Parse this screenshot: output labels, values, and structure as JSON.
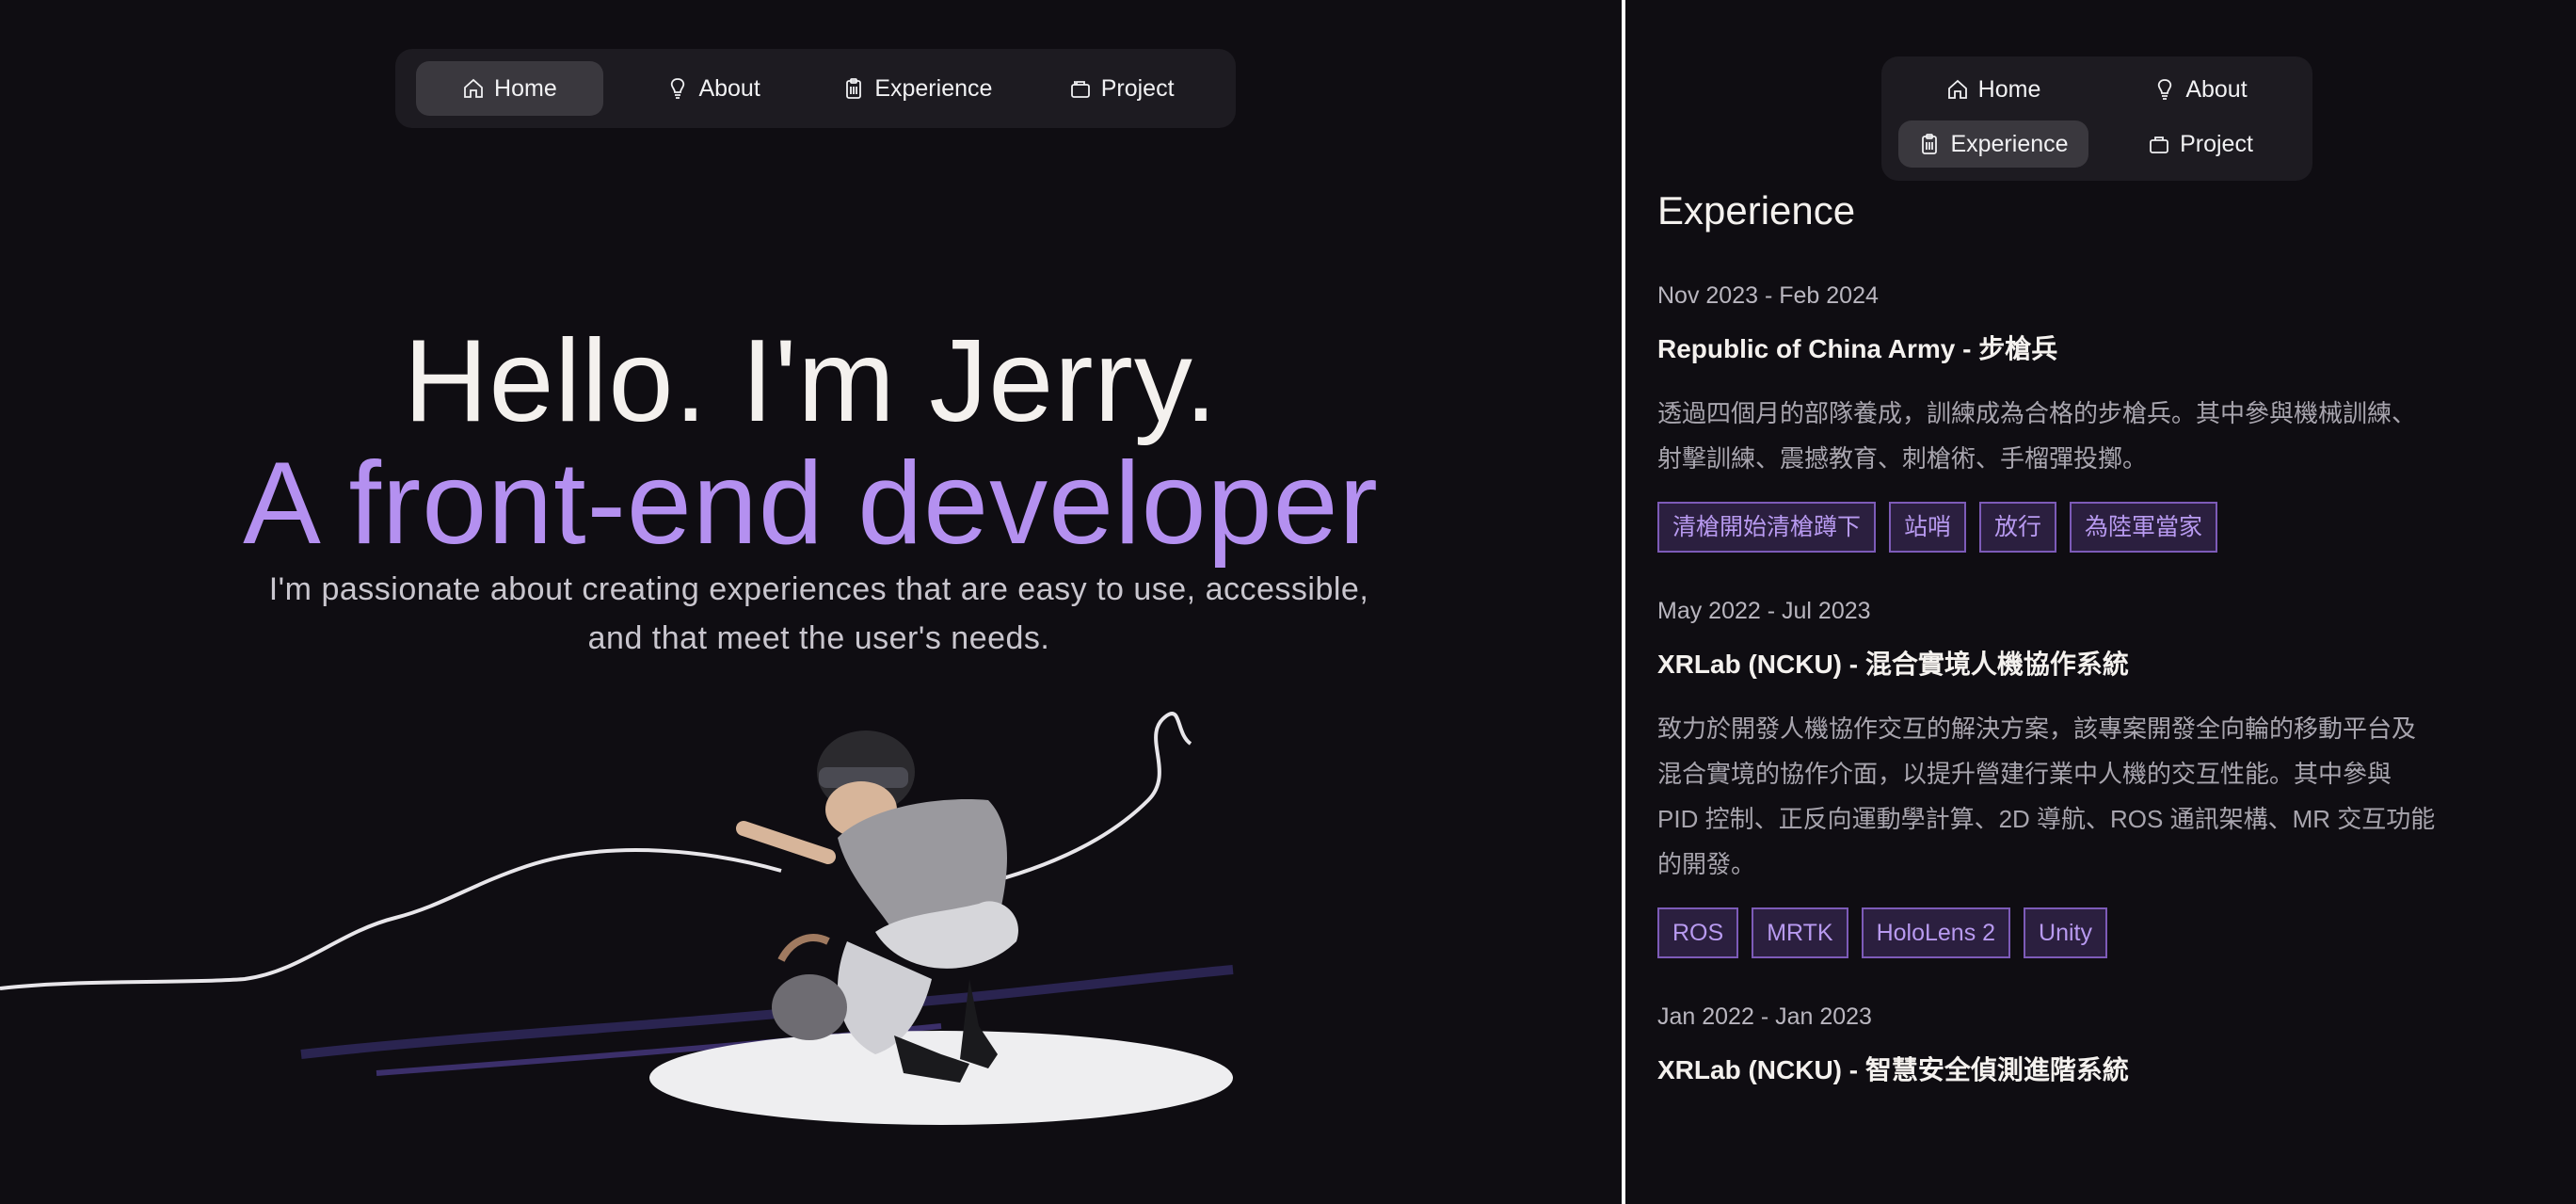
{
  "left": {
    "nav": [
      {
        "label": "Home",
        "icon": "home-icon",
        "active": true
      },
      {
        "label": "About",
        "icon": "lightbulb-icon",
        "active": false
      },
      {
        "label": "Experience",
        "icon": "clipboard-icon",
        "active": false
      },
      {
        "label": "Project",
        "icon": "briefcase-icon",
        "active": false
      }
    ],
    "hero": {
      "title": "Hello. I'm Jerry.",
      "subtitle": "A front-end developer",
      "desc_line1": "I'm passionate about creating experiences that are easy to use, accessible,",
      "desc_line2": "and that meet the user's needs."
    }
  },
  "right": {
    "nav": [
      {
        "label": "Home",
        "icon": "home-icon",
        "active": false
      },
      {
        "label": "About",
        "icon": "lightbulb-icon",
        "active": false
      },
      {
        "label": "Experience",
        "icon": "clipboard-icon",
        "active": true
      },
      {
        "label": "Project",
        "icon": "briefcase-icon",
        "active": false
      }
    ],
    "heading": "Experience",
    "items": [
      {
        "date": "Nov 2023 - Feb 2024",
        "title": "Republic of China Army - 步槍兵",
        "desc_lines": [
          "透過四個月的部隊養成，訓練成為合格的步槍兵。其中參與機械訓練、",
          "射擊訓練、震撼教育、刺槍術、手榴彈投擲。"
        ],
        "tags": [
          "清槍開始清槍蹲下",
          "站哨",
          "放行",
          "為陸軍當家"
        ]
      },
      {
        "date": "May 2022 - Jul 2023",
        "title": "XRLab (NCKU) - 混合實境人機協作系統",
        "desc_lines": [
          "致力於開發人機協作交互的解決方案，該專案開發全向輪的移動平台及",
          "混合實境的協作介面，以提升營建行業中人機的交互性能。其中參與",
          "PID 控制、正反向運動學計算、2D 導航、ROS 通訊架構、MR 交互功能",
          "的開發。"
        ],
        "tags": [
          "ROS",
          "MRTK",
          "HoloLens 2",
          "Unity"
        ]
      },
      {
        "date": "Jan 2022 - Jan 2023",
        "title": "XRLab (NCKU) - 智慧安全偵測進階系統",
        "desc_lines": [],
        "tags": []
      }
    ]
  },
  "colors": {
    "background": "#0f0d12",
    "accent_purple": "#b490f0",
    "nav_bg": "#1d1b21",
    "nav_active": "#3a383e",
    "tag_bg": "#2b1f3f",
    "tag_border": "#7d5bb8"
  }
}
